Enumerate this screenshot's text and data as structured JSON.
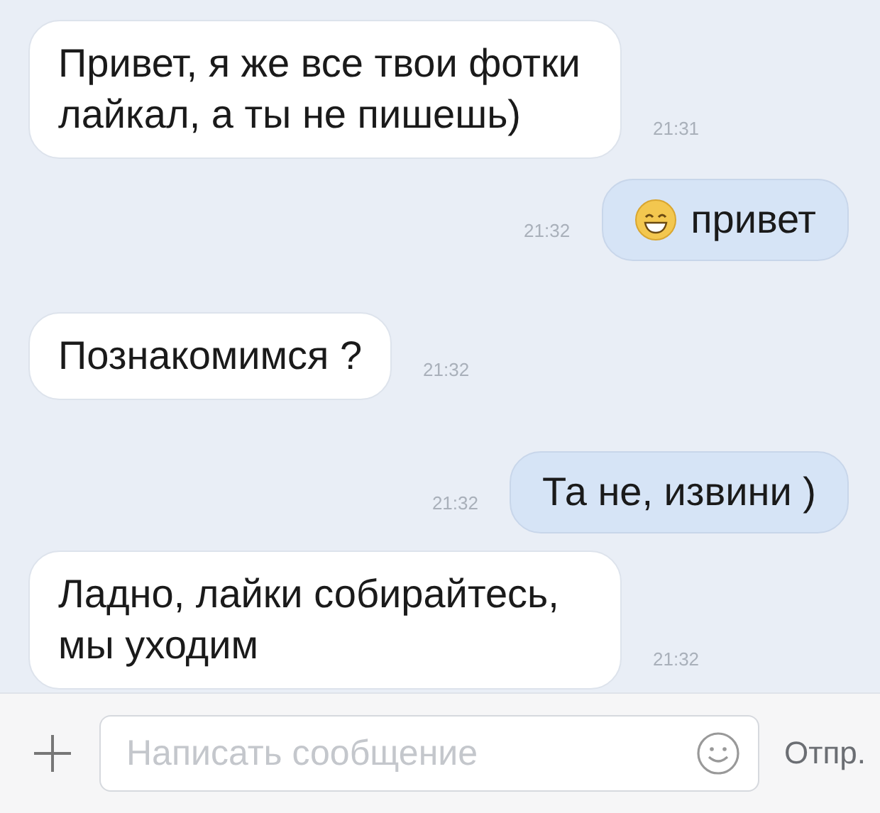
{
  "messages": [
    {
      "kind": "incoming",
      "text": "Привет, я же все твои фотки лайкал, а ты не пишешь)",
      "time": "21:31",
      "emoji": false
    },
    {
      "kind": "outgoing",
      "text": "привет",
      "time": "21:32",
      "emoji": true
    },
    {
      "kind": "incoming",
      "text": "Познакомимся ?",
      "time": "21:32",
      "emoji": false
    },
    {
      "kind": "outgoing",
      "text": "Та не, извини )",
      "time": "21:32",
      "emoji": false
    },
    {
      "kind": "incoming",
      "text": "Ладно, лайки собирайтесь, мы уходим",
      "time": "21:32",
      "emoji": false
    }
  ],
  "composer": {
    "placeholder": "Написать сообщение",
    "send": "Отпр."
  }
}
